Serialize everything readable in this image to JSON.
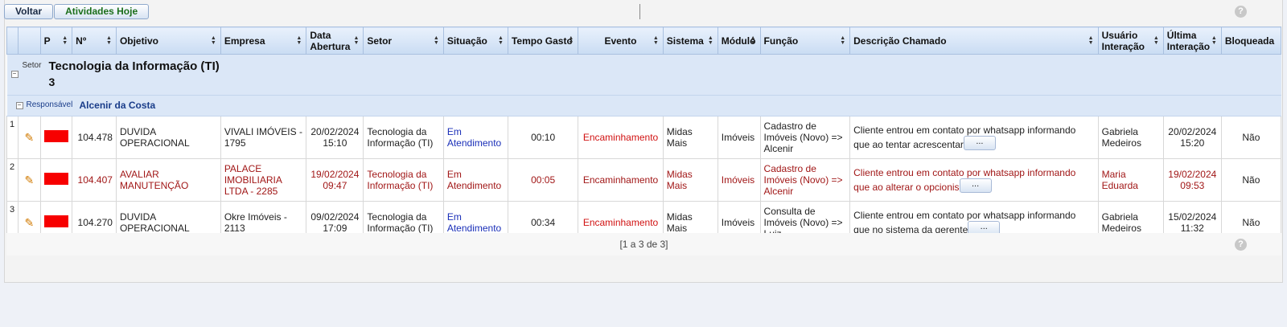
{
  "toolbar": {
    "back_label": "Voltar",
    "today_label": "Atividades Hoje",
    "help": "?"
  },
  "columns": [
    "P",
    "Nº",
    "Objetivo",
    "Empresa",
    "Data Abertura",
    "Setor",
    "Situação",
    "Tempo Gasto",
    "Evento",
    "Sistema",
    "Módulo",
    "Função",
    "Descrição Chamado",
    "Usuário Interação",
    "Última Interação",
    "Bloqueada"
  ],
  "group1": {
    "label": "Setor",
    "value": "Tecnologia da Informação (TI)",
    "count": "3"
  },
  "group2": {
    "label": "Responsável",
    "value": "Alcenir da Costa"
  },
  "rows": [
    {
      "idx": "1",
      "num": "104.478",
      "objetivo": "DUVIDA OPERACIONAL",
      "empresa": "VIVALI IMÓVEIS - 1795",
      "data": "20/02/2024 15:10",
      "setor": "Tecnologia da Informação (TI)",
      "situacao": "Em Atendimento",
      "tempo": "00:10",
      "evento": "Encaminhamento",
      "sistema": "Midas Mais",
      "modulo": "Imóveis",
      "funcao": "Cadastro de Imóveis (Novo) => Alcenir",
      "descricao": "Cliente entrou em contato por whatsapp informando que ao tentar acrescentar",
      "usuario": "Gabriela Medeiros",
      "ultima": "20/02/2024 15:20",
      "bloqueada": "Não"
    },
    {
      "idx": "2",
      "num": "104.407",
      "objetivo": "AVALIAR MANUTENÇÃO",
      "empresa": "PALACE IMOBILIARIA LTDA - 2285",
      "data": "19/02/2024 09:47",
      "setor": "Tecnologia da Informação (TI)",
      "situacao": "Em Atendimento",
      "tempo": "00:05",
      "evento": "Encaminhamento",
      "sistema": "Midas Mais",
      "modulo": "Imóveis",
      "funcao": "Cadastro de Imóveis (Novo) => Alcenir",
      "descricao": "Cliente entrou em contato por whatsapp informando que ao alterar o opcionis",
      "usuario": "Maria Eduarda",
      "ultima": "19/02/2024 09:53",
      "bloqueada": "Não"
    },
    {
      "idx": "3",
      "num": "104.270",
      "objetivo": "DUVIDA OPERACIONAL",
      "empresa": "Okre Imóveis - 2113",
      "data": "09/02/2024 17:09",
      "setor": "Tecnologia da Informação (TI)",
      "situacao": "Em Atendimento",
      "tempo": "00:34",
      "evento": "Encaminhamento",
      "sistema": "Midas Mais",
      "modulo": "Imóveis",
      "funcao": "Consulta de Imóveis (Novo) => Luiz",
      "descricao": "Cliente entrou em contato por whatsapp informando que no sistema da gerente",
      "usuario": "Gabriela Medeiros",
      "ultima": "15/02/2024 11:32",
      "bloqueada": "Não"
    }
  ],
  "more_label": "...",
  "pager": "[1 a 3 de 3]",
  "colors": {
    "priority": "#f70000",
    "row_alert": "#a11717",
    "status_blue": "#1a2fb8",
    "event_red": "#d11212"
  },
  "icons": {
    "edit": "pencil-icon",
    "help": "help-icon",
    "toggle": "collapse-icon"
  }
}
